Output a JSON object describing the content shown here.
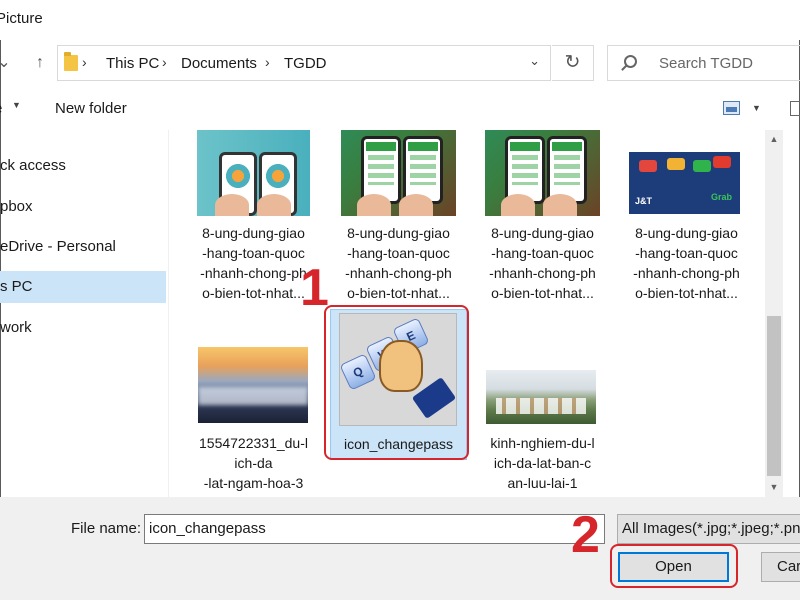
{
  "title": "Picture",
  "address": {
    "crumbs": [
      "This PC",
      "Documents",
      "TGDD"
    ]
  },
  "search": {
    "placeholder": "Search TGDD"
  },
  "toolbar": {
    "new_folder": "New folder"
  },
  "nav_pane": {
    "items": [
      {
        "label": "ck access",
        "selected": false
      },
      {
        "label": "pbox",
        "selected": false
      },
      {
        "label": "eDrive - Personal",
        "selected": false
      },
      {
        "label": "s PC",
        "selected": true
      },
      {
        "label": "work",
        "selected": false
      }
    ]
  },
  "files": [
    {
      "name_lines": [
        "8-ung-dung-giao",
        "-hang-toan-quoc",
        "-nhanh-chong-ph",
        "o-bien-tot-nhat..."
      ]
    },
    {
      "name_lines": [
        "8-ung-dung-giao",
        "-hang-toan-quoc",
        "-nhanh-chong-ph",
        "o-bien-tot-nhat..."
      ]
    },
    {
      "name_lines": [
        "8-ung-dung-giao",
        "-hang-toan-quoc",
        "-nhanh-chong-ph",
        "o-bien-tot-nhat..."
      ]
    },
    {
      "name_lines": [
        "8-ung-dung-giao",
        "-hang-toan-quoc",
        "-nhanh-chong-ph",
        "o-bien-tot-nhat..."
      ]
    },
    {
      "name_lines": [
        "1554722331_du-l",
        "ich-da",
        "-lat-ngam-hoa-3"
      ]
    },
    {
      "name_lines": [
        "icon_changepass"
      ],
      "selected": true
    },
    {
      "name_lines": [
        "kinh-nghiem-du-l",
        "ich-da-lat-ban-c",
        "an-luu-lai-1"
      ]
    }
  ],
  "thumb_text": {
    "keys": [
      "Q",
      "W",
      "E"
    ],
    "brands": [
      "J&T",
      "Grab"
    ]
  },
  "bottom": {
    "file_name_label": "File name:",
    "file_name_value": "icon_changepass",
    "filter": "All Images(*.jpg;*.jpeg;*.pn",
    "open": "Open",
    "cancel": "Car"
  },
  "annotations": {
    "step1": "1",
    "step2": "2"
  },
  "colors": {
    "selection": "#cce4f7",
    "accent": "#0078d7",
    "annotation": "#d6262b"
  }
}
